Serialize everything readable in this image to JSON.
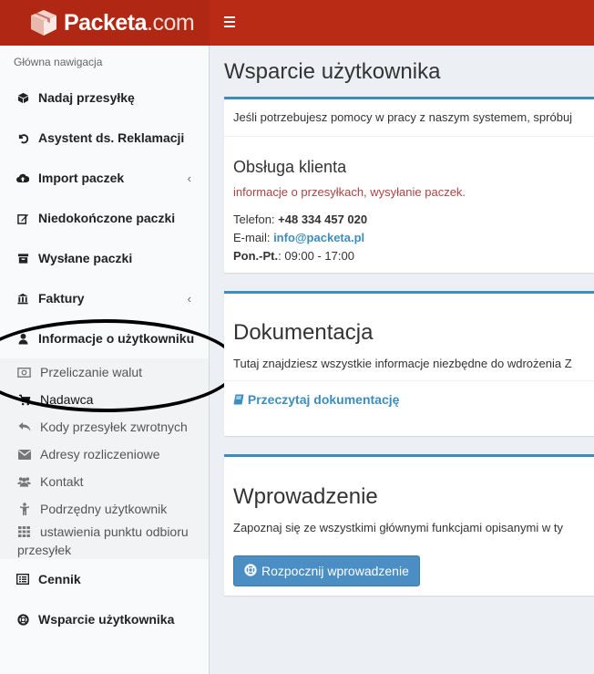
{
  "header": {
    "logo_bold": "Packeta",
    "logo_light": ".com",
    "menu_icon": "hamburger-icon"
  },
  "sidebar": {
    "nav_header": "Główna nawigacja",
    "items": [
      {
        "label": "Nadaj przesyłkę",
        "icon": "cube-icon"
      },
      {
        "label": "Asystent ds. Reklamacji",
        "icon": "undo-icon"
      },
      {
        "label": "Import paczek",
        "icon": "cloud-upload-icon",
        "chevron": "‹"
      },
      {
        "label": "Niedokończone paczki",
        "icon": "edit-icon"
      },
      {
        "label": "Wysłane paczki",
        "icon": "archive-icon"
      },
      {
        "label": "Faktury",
        "icon": "bank-icon",
        "chevron": "‹"
      },
      {
        "label": "Informacje o użytkowniku",
        "icon": "user-icon"
      }
    ],
    "subitems": [
      {
        "label": "Przeliczanie walut",
        "icon": "money-icon"
      },
      {
        "label": "Nadawca",
        "icon": "cart-icon"
      },
      {
        "label": "Kody przesyłek zwrotnych",
        "icon": "reply-icon"
      },
      {
        "label": "Adresy rozliczeniowe",
        "icon": "envelope-icon"
      },
      {
        "label": "Kontakt",
        "icon": "users-icon"
      },
      {
        "label": "Podrzędny użytkownik",
        "icon": "child-icon"
      },
      {
        "label": "ustawienia punktu odbioru przesyłek",
        "icon": "grid-icon"
      }
    ],
    "bottom_items": [
      {
        "label": "Cennik",
        "icon": "list-alt-icon"
      },
      {
        "label": "Wsparcie użytkownika",
        "icon": "life-ring-icon"
      }
    ]
  },
  "main": {
    "page_title": "Wsparcie użytkownika",
    "support_box": {
      "intro": "Jeśli potrzebujesz pomocy w pracy z naszym systemem, spróbuj",
      "title": "Obsługa klienta",
      "subtitle": "informacje o przesyłkach, wysyłanie paczek.",
      "phone_label": "Telefon: ",
      "phone": "+48 334 457 020",
      "email_label": "E-mail: ",
      "email": "info@packeta.pl",
      "hours_label": "Pon.-Pt.",
      "hours": ": 09:00 - 17:00"
    },
    "docs_box": {
      "title": "Dokumentacja",
      "desc": "Tutaj znajdziesz wszystkie informacje niezbędne do wdrożenia Z",
      "link": "Przeczytaj dokumentację",
      "link_icon": "book-icon"
    },
    "intro_box": {
      "title": "Wprowadzenie",
      "desc": "Zapoznaj się ze wszystkimi głównymi funkcjami opisanymi w ty",
      "button": "Rozpocznij wprowadzenie",
      "button_icon": "life-ring-icon"
    }
  },
  "colors": {
    "header": "#ba2b16",
    "logo_bg": "#b02813",
    "accent": "#3c8dbc",
    "button": "#4a8ec4",
    "red_text": "#a94442"
  }
}
